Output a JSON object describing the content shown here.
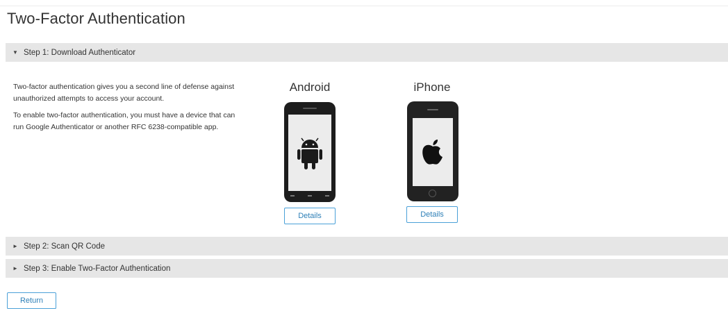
{
  "page": {
    "title": "Two-Factor Authentication"
  },
  "steps": [
    {
      "label": "Step 1: Download Authenticator",
      "arrow": "▼"
    },
    {
      "label": "Step 2: Scan QR Code",
      "arrow": "►"
    },
    {
      "label": "Step 3: Enable Two-Factor Authentication",
      "arrow": "►"
    }
  ],
  "description": {
    "p1": "Two-factor authentication gives you a second line of defense against unauthorized attempts to access your account.",
    "p2": "To enable two-factor authentication, you must have a device that can run Google Authenticator or another RFC 6238-compatible app."
  },
  "devices": {
    "android": {
      "label": "Android",
      "button": "Details",
      "icon": "android-icon"
    },
    "iphone": {
      "label": "iPhone",
      "button": "Details",
      "icon": "apple-icon"
    }
  },
  "footer": {
    "return_label": "Return"
  },
  "colors": {
    "accent": "#2d7fb7",
    "bar": "#e6e6e6"
  }
}
